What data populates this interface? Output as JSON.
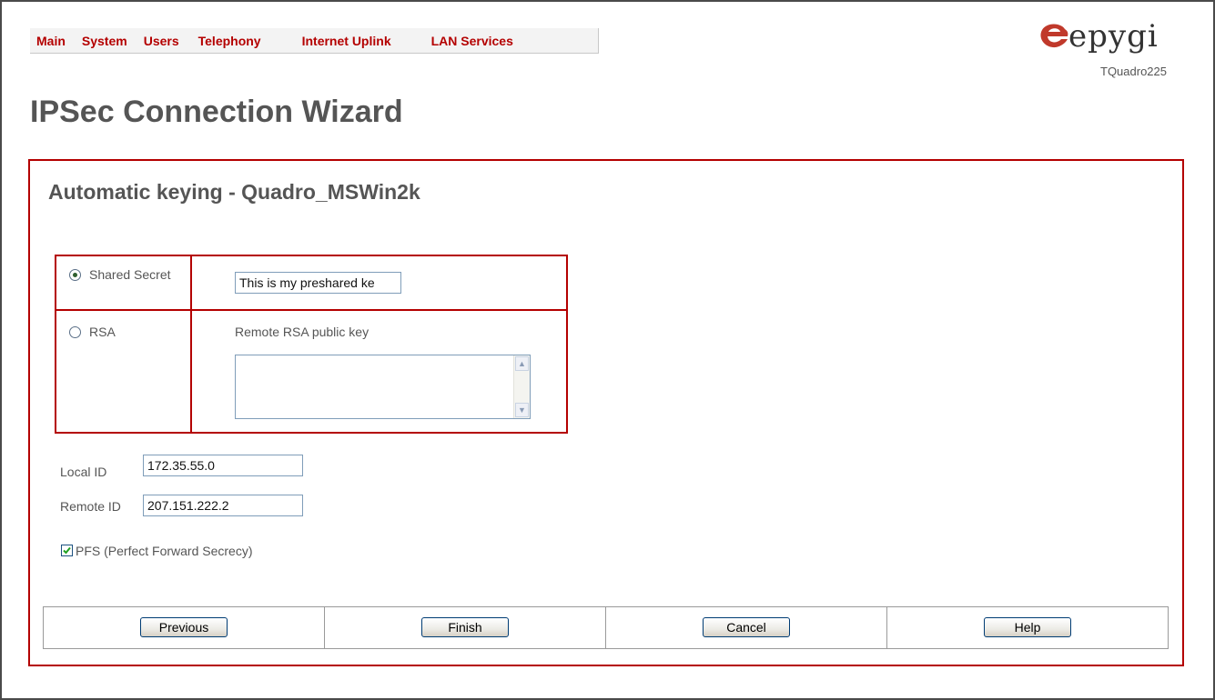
{
  "menu": {
    "items": [
      {
        "label": "Main"
      },
      {
        "label": "System"
      },
      {
        "label": "Users"
      },
      {
        "label": "Telephony"
      },
      {
        "label": "Internet Uplink"
      },
      {
        "label": "LAN Services"
      }
    ]
  },
  "logo": {
    "text": "epygi",
    "model": "TQuadro225",
    "brand_color": "#c0392b"
  },
  "page": {
    "title": "IPSec Connection Wizard",
    "section_title": "Automatic keying - Quadro_MSWin2k"
  },
  "keying": {
    "shared_secret_label": "Shared Secret",
    "shared_secret_selected": true,
    "shared_secret_value": "This is my preshared ke",
    "rsa_label": "RSA",
    "rsa_selected": false,
    "rsa_key_label": "Remote RSA public key",
    "rsa_key_value": ""
  },
  "ids": {
    "local_label": "Local ID",
    "local_value": "172.35.55.0",
    "remote_label": "Remote ID",
    "remote_value": "207.151.222.2"
  },
  "pfs": {
    "label": "PFS (Perfect Forward Secrecy)",
    "checked": true
  },
  "buttons": {
    "previous": "Previous",
    "finish": "Finish",
    "cancel": "Cancel",
    "help": "Help"
  },
  "colors": {
    "accent": "#b40000",
    "heading": "#555555"
  }
}
